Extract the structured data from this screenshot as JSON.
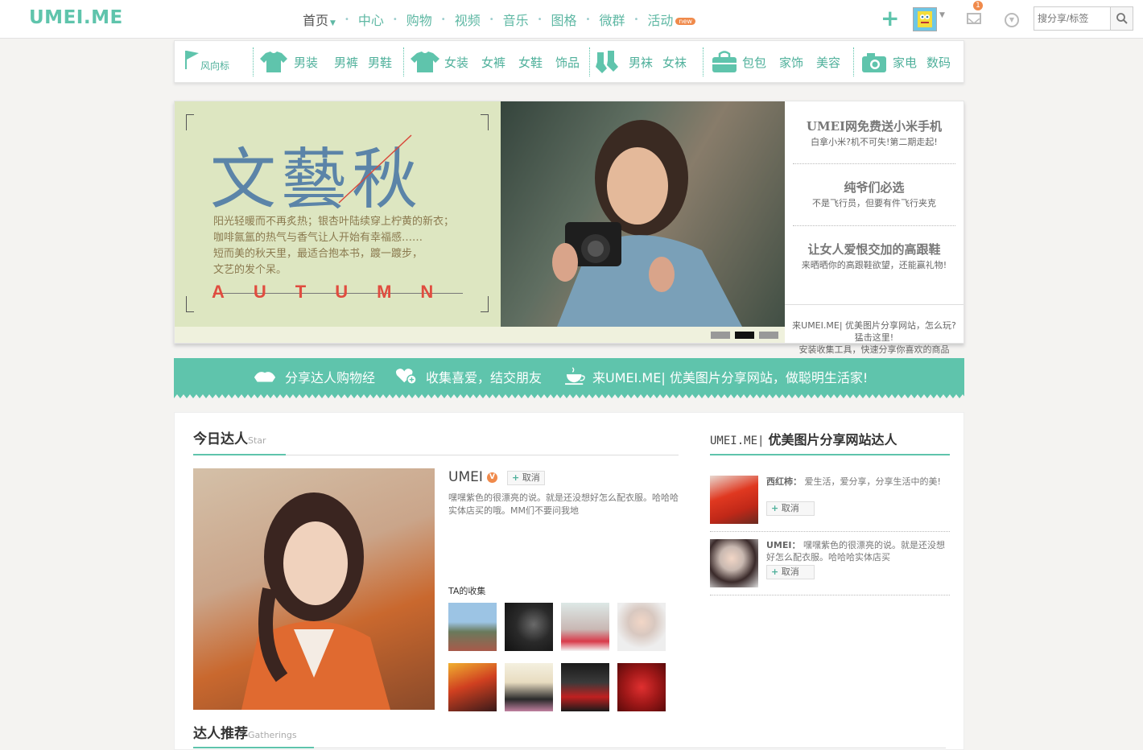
{
  "header": {
    "logo": "UMEI.ME",
    "nav": [
      {
        "label": "首页",
        "home": true
      },
      {
        "label": "中心"
      },
      {
        "label": "购物"
      },
      {
        "label": "视频"
      },
      {
        "label": "音乐"
      },
      {
        "label": "图格"
      },
      {
        "label": "微群"
      },
      {
        "label": "活动",
        "badge": "new"
      }
    ],
    "mail_badge": "1",
    "search_placeholder": "搜分享/标签"
  },
  "categories": {
    "flag": "风向标",
    "items": [
      "男装",
      "男裤",
      "男鞋",
      "女装",
      "女裤",
      "女鞋",
      "饰品",
      "男袜",
      "女袜",
      "包包",
      "家饰",
      "美容",
      "家电",
      "数码"
    ]
  },
  "banner": {
    "title": "文藝秋",
    "lines": [
      "阳光轻暖而不再炙热；银杏叶陆续穿上柠黄的新衣；",
      "咖啡氤氲的热气与香气让人开始有幸福感……",
      "短而美的秋天里，最适合抱本书，踱一踱步，",
      "文艺的发个呆。"
    ],
    "autumn": "AUTUMN",
    "promos": [
      {
        "title": "UMEI网免费送小米手机",
        "sub": "白拿小米?机不可失!第二期走起!"
      },
      {
        "title": "纯爷们必选",
        "sub": "不是飞行员，但要有件飞行夹克"
      },
      {
        "title": "让女人爱恨交加的高跟鞋",
        "sub": "来晒晒你的高跟鞋欲望，还能赢礼物!"
      }
    ],
    "info": [
      "来UMEI.ME| 优美图片分享网站，怎么玩?",
      "猛击这里!",
      "安装收集工具，快速分享你喜欢的商品"
    ]
  },
  "strip": [
    "分享达人购物经",
    "收集喜爱，结交朋友",
    "来UMEI.ME| 优美图片分享网站，做聪明生活家!"
  ],
  "today_star": {
    "title": "今日达人",
    "title_en": "Star",
    "name": "UMEI",
    "verified": "V",
    "follow_plus": "+",
    "follow": "取消",
    "desc": "嘿嘿紫色的很漂亮的说。就是还没想好怎么配衣服。哈哈哈实体店买的哦。MM们不要问我地",
    "collect_label": "TA的收集"
  },
  "recommend": {
    "title": "达人推荐",
    "title_en": "Gatherings"
  },
  "right": {
    "title_pre": "UMEI.ME|",
    "title_main": "优美图片分享网站达人",
    "items": [
      {
        "name": "西红柿：",
        "text": "爱生活，爱分享，分享生活中的美!",
        "plus": "+",
        "follow": "取消"
      },
      {
        "name": "UMEI：",
        "text": "嘿嘿紫色的很漂亮的说。就是还没想好怎么配衣服。哈哈哈实体店买",
        "plus": "+",
        "follow": "取消"
      }
    ]
  }
}
